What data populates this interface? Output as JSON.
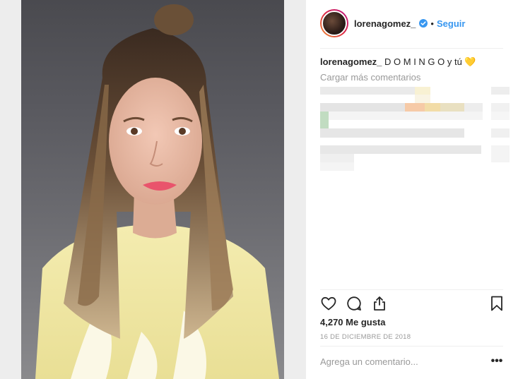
{
  "post": {
    "username": "lorenagomez_",
    "follow_label": "Seguir",
    "separator": "•",
    "caption_user": "lorenagomez_",
    "caption_text": " D O M I N G O y tú 💛",
    "load_more": "Cargar más comentarios",
    "likes": "4,270 Me gusta",
    "date": "16 DE DICIEMBRE DE 2018",
    "comment_placeholder": "Agrega un comentario...",
    "more_label": "•••"
  },
  "colors": {
    "accent": "#3897f0",
    "secondary_text": "#999999",
    "primary_text": "#262626"
  },
  "icons": [
    "verified-badge-icon",
    "heart-icon",
    "comment-icon",
    "share-icon",
    "bookmark-icon",
    "more-options-icon"
  ]
}
